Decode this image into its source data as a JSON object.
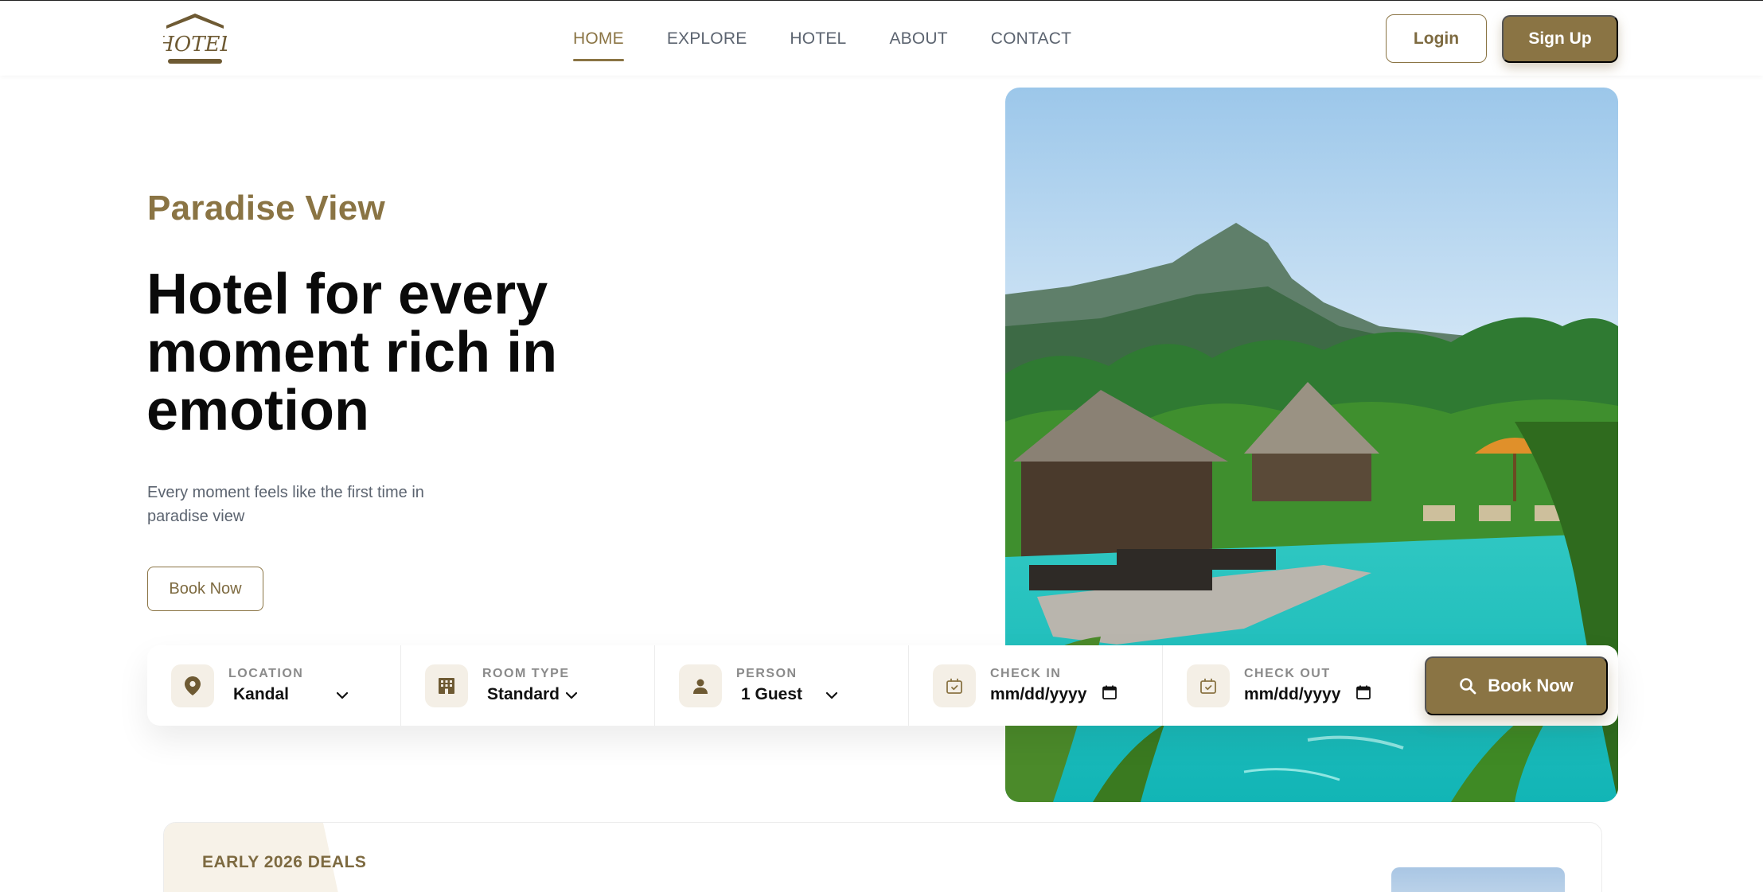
{
  "brand": {
    "logo_text": "HOTEL",
    "accent": "#8a7444"
  },
  "nav": {
    "items": [
      {
        "label": "HOME",
        "active": true
      },
      {
        "label": "EXPLORE",
        "active": false
      },
      {
        "label": "HOTEL",
        "active": false
      },
      {
        "label": "ABOUT",
        "active": false
      },
      {
        "label": "CONTACT",
        "active": false
      }
    ],
    "login_label": "Login",
    "signup_label": "Sign Up"
  },
  "hero": {
    "subtitle": "Paradise View",
    "headline": "Hotel for every moment rich in emotion",
    "description": "Every moment feels like the first time in paradise view",
    "cta_label": "Book Now",
    "image_icon": "resort-pool-photo"
  },
  "booking": {
    "location": {
      "label": "LOCATION",
      "value": "Kandal",
      "icon": "location-pin-icon"
    },
    "room_type": {
      "label": "ROOM TYPE",
      "value": "Standard",
      "icon": "building-icon"
    },
    "person": {
      "label": "PERSON",
      "value": "1 Guest",
      "icon": "person-icon"
    },
    "check_in": {
      "label": "CHECK IN",
      "placeholder": "mm/dd/yyyy",
      "icon": "calendar-check-icon"
    },
    "check_out": {
      "label": "CHECK OUT",
      "placeholder": "mm/dd/yyyy",
      "icon": "calendar-check-icon"
    },
    "submit_label": "Book Now"
  },
  "deals": {
    "title": "EARLY 2026 DEALS"
  }
}
